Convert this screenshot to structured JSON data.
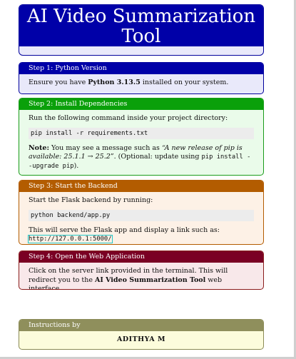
{
  "title": {
    "line1": "AI Video Summarization",
    "line2": "Tool"
  },
  "step1": {
    "heading": "Step 1: Python Version",
    "text_before": "Ensure you have ",
    "text_bold": "Python 3.13.5",
    "text_after": " installed on your system."
  },
  "step2": {
    "heading": "Step 2: Install Dependencies",
    "intro": "Run the following command inside your project directory:",
    "command": "pip install -r requirements.txt",
    "note_label": "Note:",
    "note_text1": " You may see a message such as ",
    "note_quote": "“A new release of pip is available: 25.1.1 → 25.2”",
    "note_text2": ". (Optional: update using ",
    "note_cmd": "pip install --upgrade pip",
    "note_end": ")."
  },
  "step3": {
    "heading": "Step 3: Start the Backend",
    "intro": "Start the Flask backend by running:",
    "command": "python backend/app.py",
    "text": "This will serve the Flask app and display a link such as: ",
    "link": "http://127.0.0.1:5000/"
  },
  "step4": {
    "heading": "Step 4: Open the Web Application",
    "text1": "Click on the server link provided in the terminal. This will redirect you to the ",
    "text_bold": "AI Video Summarization Tool",
    "text2": " web interface."
  },
  "credits": {
    "heading": "Instructions by",
    "name": "ADITHYA M"
  },
  "colors": {
    "blue": "#0000a8",
    "green": "#0aa00a",
    "orange": "#b35c00",
    "maroon": "#7a0024",
    "olive": "#8f8f5c"
  }
}
